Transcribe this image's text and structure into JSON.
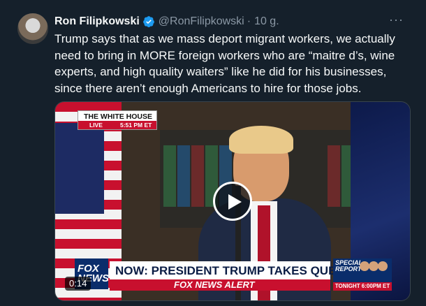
{
  "tweet": {
    "author_name": "Ron Filipkowski",
    "handle": "@RonFilipkowski",
    "separator": "·",
    "time": "10 g.",
    "more_label": "···",
    "body": "Trump says that as we mass deport migrant workers, we actually need to bring in MORE foreign workers who are “maitre d’s, wine experts, and high quality waiters” like he did for his businesses, since there aren’t enough Americans to hire for those jobs.",
    "verified_color": "#1d9bf0"
  },
  "video": {
    "duration": "0:14",
    "network_badge_title": "THE WHITE HOUSE",
    "live_label": "LIVE",
    "live_time": "5:51 PM ET",
    "fox_logo": "FOX NEWS",
    "headline": "NOW: PRESIDENT TRUMP TAKES QUESTIONS",
    "alert": "FOX NEWS ALERT",
    "special_label": "SPECIAL REPORT",
    "special_time": "TONIGHT 6:00PM ET",
    "play_icon": "play-icon"
  }
}
